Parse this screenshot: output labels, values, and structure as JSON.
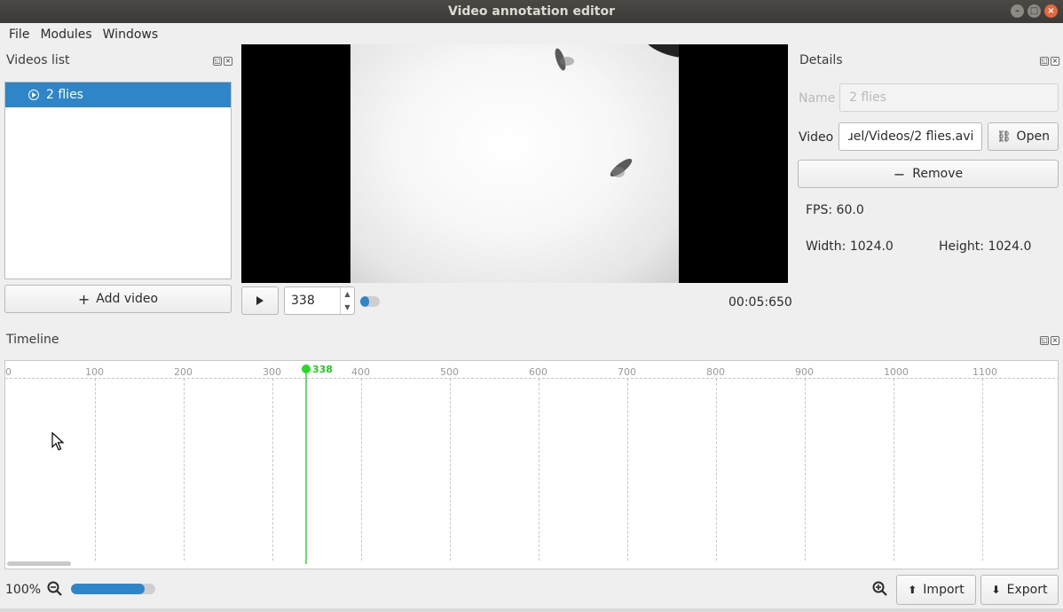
{
  "window": {
    "title": "Video annotation editor"
  },
  "menu": [
    "File",
    "Modules",
    "Windows"
  ],
  "videos_dock": {
    "title": "Videos list",
    "items": [
      {
        "label": "2 flies",
        "selected": true
      }
    ],
    "add_label": "Add video"
  },
  "player": {
    "frame": "338",
    "time": "00:05:650",
    "toggle_fraction": 0.45
  },
  "details_dock": {
    "title": "Details",
    "name_label": "Name",
    "name_value": "2 flies",
    "video_label": "Video",
    "video_value": "ɹel/Videos/2 flies.avi",
    "open_label": "Open",
    "remove_label": "Remove",
    "fps": "FPS: 60.0",
    "width": "Width: 1024.0",
    "height": "Height: 1024.0"
  },
  "timeline_dock": {
    "title": "Timeline",
    "ticks": [
      "0",
      "100",
      "200",
      "300",
      "400",
      "500",
      "600",
      "700",
      "800",
      "900",
      "1000",
      "1100"
    ],
    "playhead_frame": 338,
    "playhead_label": "338",
    "zoom_label": "100%",
    "zoom_fraction": 0.87,
    "import_label": "Import",
    "export_label": "Export"
  },
  "colors": {
    "accent": "#2e86c9",
    "playhead": "#22dd22"
  }
}
